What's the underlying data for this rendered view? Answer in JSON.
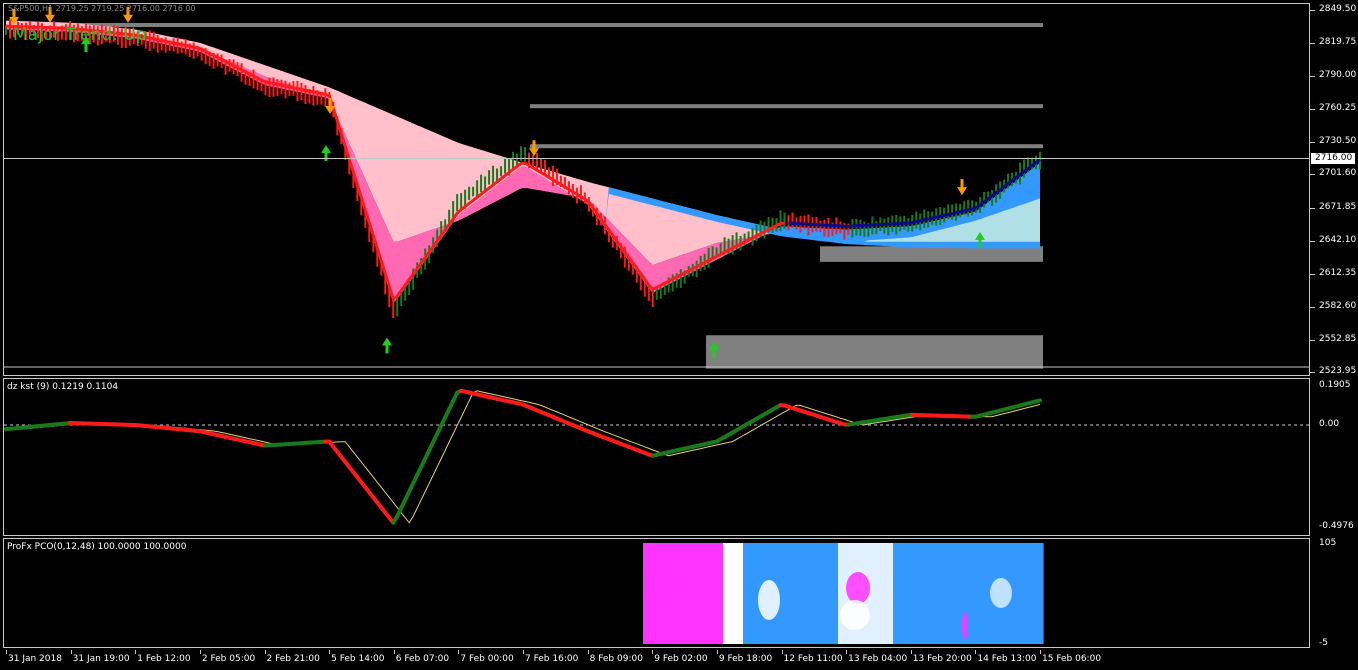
{
  "window": {
    "title": "S&P500,H1  2719.25 2719.25 2716.00 2716.00"
  },
  "main_chart": {
    "label": "Major Trend: Up",
    "current_price": "2716.00",
    "price_scale": [
      "2849.50",
      "2819.75",
      "2790.00",
      "2760.25",
      "2730.50",
      "2716.00",
      "2701.60",
      "2671.85",
      "2642.10",
      "2612.35",
      "2582.60",
      "2552.85",
      "2523.95"
    ]
  },
  "kst": {
    "label": "dz kst (9) 0.1219 0.1104",
    "scale": [
      "0.1905",
      "0.00",
      "-0.4976"
    ]
  },
  "pco": {
    "label": "ProFx PCO(0,12,48) 100.0000 100.0000",
    "scale": [
      "105",
      "-5"
    ]
  },
  "x_axis": [
    "31 Jan 2018",
    "31 Jan 19:00",
    "1 Feb 12:00",
    "2 Feb 05:00",
    "2 Feb 21:00",
    "5 Feb 14:00",
    "6 Feb 07:00",
    "7 Feb 00:00",
    "7 Feb 16:00",
    "8 Feb 09:00",
    "9 Feb 02:00",
    "9 Feb 18:00",
    "12 Feb 11:00",
    "13 Feb 04:00",
    "13 Feb 20:00",
    "14 Feb 13:00",
    "15 Feb 06:00"
  ],
  "colors": {
    "background": "#000000",
    "price_up": "#1a7a1a",
    "price_down": "#ff1a1a",
    "trend_line": "#ff1a1a",
    "trend_line_up": "#0a0a8c",
    "cloud_pink": "#ffc0cb",
    "cloud_hotpink": "#ff69b4",
    "cloud_blue": "#3399ff",
    "cloud_lightblue": "#b0e0e6",
    "zone_gray": "#808080",
    "arrow_up": "#22cc22",
    "arrow_down": "#ff9900",
    "kst_up": "#1a7a1a",
    "kst_down": "#ff1a1a",
    "pco_magenta": "#ff33ff",
    "pco_blue": "#3399ff"
  },
  "chart_data": [
    {
      "type": "line",
      "title": "Major Trend: Up",
      "x": [
        "31 Jan 2018",
        "31 Jan 19:00",
        "1 Feb 12:00",
        "2 Feb 05:00",
        "2 Feb 21:00",
        "5 Feb 14:00",
        "6 Feb 07:00",
        "7 Feb 00:00",
        "7 Feb 16:00",
        "8 Feb 09:00",
        "9 Feb 02:00",
        "9 Feb 18:00",
        "12 Feb 11:00",
        "13 Feb 04:00",
        "13 Feb 20:00",
        "14 Feb 13:00",
        "15 Feb 06:00"
      ],
      "series": [
        {
          "values": [
            2832,
            2830,
            2824,
            2812,
            2782,
            2770,
            2578,
            2676,
            2720,
            2678,
            2590,
            2632,
            2660,
            2652,
            2658,
            2672,
            2716
          ]
        }
      ],
      "ylim": [
        2523.95,
        2849.5
      ],
      "current_price": 2716.0,
      "resistance_lines": [
        2836,
        2763,
        2727
      ],
      "support_zones": [
        [
          2623,
          2637
        ],
        [
          2527,
          2557
        ]
      ]
    },
    {
      "type": "line",
      "title": "dz kst (9) 0.1219 0.1104",
      "x": [
        "31 Jan 2018",
        "31 Jan 19:00",
        "1 Feb 12:00",
        "2 Feb 05:00",
        "2 Feb 21:00",
        "5 Feb 14:00",
        "6 Feb 07:00",
        "7 Feb 00:00",
        "7 Feb 16:00",
        "8 Feb 09:00",
        "9 Feb 02:00",
        "9 Feb 18:00",
        "12 Feb 11:00",
        "13 Feb 04:00",
        "13 Feb 20:00",
        "14 Feb 13:00",
        "15 Feb 06:00"
      ],
      "series": [
        {
          "values": [
            -0.02,
            0.01,
            0.0,
            -0.03,
            -0.1,
            -0.08,
            -0.48,
            0.17,
            0.1,
            -0.03,
            -0.15,
            -0.08,
            0.1,
            0.0,
            0.05,
            0.04,
            0.12
          ]
        }
      ],
      "ylim": [
        -0.4976,
        0.1905
      ]
    },
    {
      "type": "heatmap",
      "title": "ProFx PCO(0,12,48) 100.0000 100.0000",
      "ylim": [
        -5,
        105
      ]
    }
  ]
}
